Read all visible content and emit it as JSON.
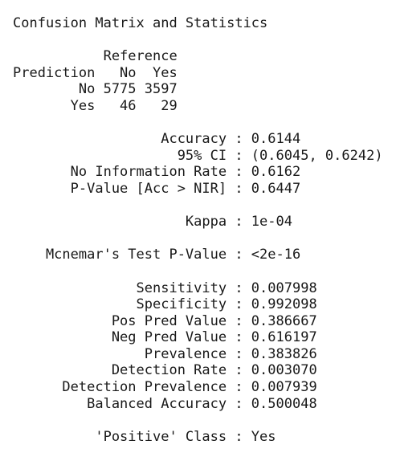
{
  "title": "Confusion Matrix and Statistics",
  "matrix": {
    "reference_label": "Reference",
    "prediction_label": "Prediction",
    "col_no": "No",
    "col_yes": "Yes",
    "rows": [
      {
        "label": "No",
        "no": "5775",
        "yes": "3597"
      },
      {
        "label": "Yes",
        "no": "46",
        "yes": "29"
      }
    ]
  },
  "overall": [
    {
      "label": "Accuracy",
      "value": "0.6144"
    },
    {
      "label": "95% CI",
      "value": "(0.6045, 0.6242)"
    },
    {
      "label": "No Information Rate",
      "value": "0.6162"
    },
    {
      "label": "P-Value [Acc > NIR]",
      "value": "0.6447"
    }
  ],
  "kappa": {
    "label": "Kappa",
    "value": "1e-04"
  },
  "mcnemar": {
    "label": "Mcnemar's Test P-Value",
    "value": "<2e-16"
  },
  "class_stats": [
    {
      "label": "Sensitivity",
      "value": "0.007998"
    },
    {
      "label": "Specificity",
      "value": "0.992098"
    },
    {
      "label": "Pos Pred Value",
      "value": "0.386667"
    },
    {
      "label": "Neg Pred Value",
      "value": "0.616197"
    },
    {
      "label": "Prevalence",
      "value": "0.383826"
    },
    {
      "label": "Detection Rate",
      "value": "0.003070"
    },
    {
      "label": "Detection Prevalence",
      "value": "0.007939"
    },
    {
      "label": "Balanced Accuracy",
      "value": "0.500048"
    }
  ],
  "positive_class": {
    "label": "'Positive' Class",
    "value": "Yes"
  }
}
